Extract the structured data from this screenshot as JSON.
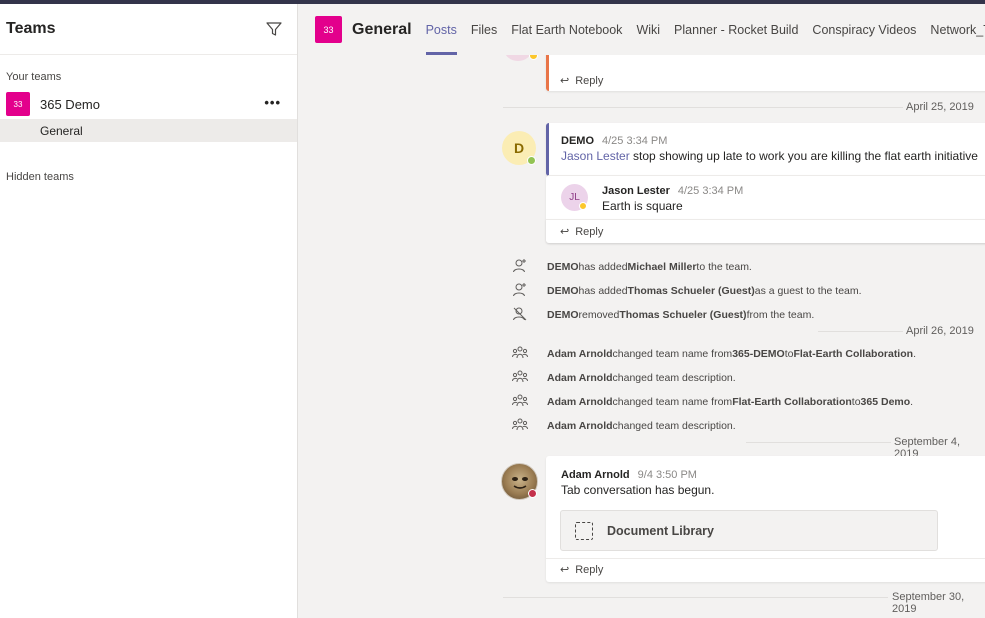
{
  "sidebar": {
    "title": "Teams",
    "your_teams_label": "Your teams",
    "team": {
      "avatar_text": "33",
      "name": "365 Demo",
      "more": "•••"
    },
    "channel": "General",
    "hidden_teams_label": "Hidden teams"
  },
  "header": {
    "avatar_text": "33",
    "title": "General",
    "tabs": [
      "Posts",
      "Files",
      "Flat Earth Notebook",
      "Wiki",
      "Planner - Rocket Build",
      "Conspiracy Videos",
      "Network_Team_D"
    ]
  },
  "feed": {
    "reply_label": "Reply",
    "dates": [
      "April 25, 2019",
      "April 26, 2019",
      "September 4, 2019",
      "September 30, 2019"
    ],
    "post1": {
      "avatar_letter": "D",
      "author": "DEMO",
      "time": "4/25 3:34 PM",
      "mention": "Jason Lester",
      "text": " stop showing up late to work you are killing the flat earth initiative",
      "reply": {
        "avatar_initials": "JL",
        "author": "Jason Lester",
        "time": "4/25 3:34 PM",
        "text": "Earth is square"
      }
    },
    "system_events": [
      {
        "icon": "add-member-icon",
        "actor": "DEMO",
        "mid": " has added ",
        "target": "Michael Miller",
        "end": " to the team."
      },
      {
        "icon": "add-member-icon",
        "actor": "DEMO",
        "mid": " has added ",
        "target": "Thomas Schueler (Guest)",
        "end": " as a guest to the team."
      },
      {
        "icon": "remove-member-icon",
        "actor": "DEMO",
        "mid": " removed ",
        "target": "Thomas Schueler (Guest)",
        "end": " from the team."
      }
    ],
    "team_events": [
      {
        "actor": "Adam Arnold",
        "pre": " changed team name from ",
        "a": "365-DEMO",
        "mid": " to ",
        "b": "Flat-Earth Collaboration",
        "end": "."
      },
      {
        "actor": "Adam Arnold",
        "pre": " changed team description.",
        "a": "",
        "mid": "",
        "b": "",
        "end": ""
      },
      {
        "actor": "Adam Arnold",
        "pre": " changed team name from ",
        "a": "Flat-Earth Collaboration",
        "mid": " to ",
        "b": "365 Demo",
        "end": "."
      },
      {
        "actor": "Adam Arnold",
        "pre": " changed team description.",
        "a": "",
        "mid": "",
        "b": "",
        "end": ""
      }
    ],
    "post2": {
      "author": "Adam Arnold",
      "time": "9/4 3:50 PM",
      "text": "Tab conversation has begun.",
      "attachment": "Document Library"
    }
  },
  "colors": {
    "brand": "#6264a7",
    "team_avatar": "#e3008c",
    "online": "#92c353",
    "away": "#fcc72c",
    "busy": "#c4314b"
  }
}
